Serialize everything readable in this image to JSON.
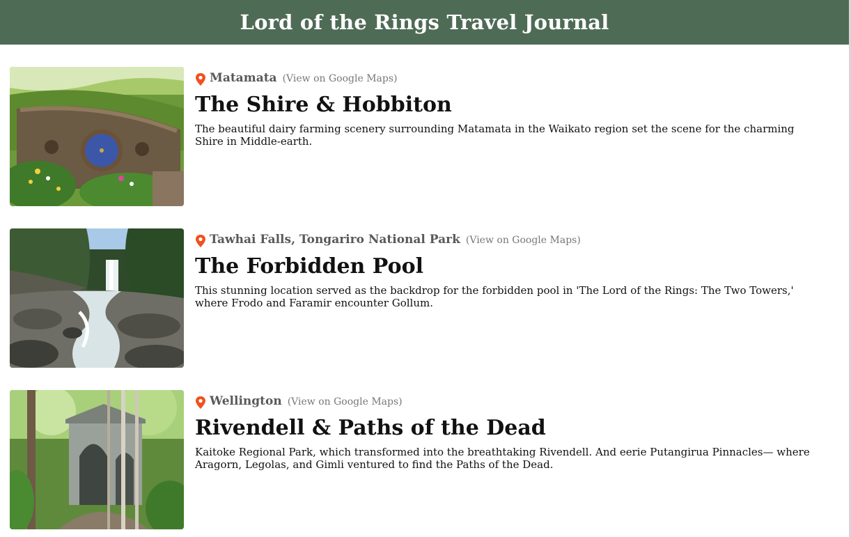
{
  "header": {
    "title": "Lord of the Rings Travel Journal"
  },
  "entries": [
    {
      "location": "Matamata",
      "maps_link": "(View on Google Maps)",
      "title": "The Shire & Hobbiton",
      "description": "The beautiful dairy farming scenery surrounding Matamata in the Waikato region set the scene for the charming Shire in Middle-earth."
    },
    {
      "location": "Tawhai Falls, Tongariro National Park",
      "maps_link": "(View on Google Maps)",
      "title": "The Forbidden Pool",
      "description": "This stunning location served as the backdrop for the forbidden pool in 'The Lord of the Rings: The Two Towers,' where Frodo and Faramir encounter Gollum."
    },
    {
      "location": "Wellington",
      "maps_link": "(View on Google Maps)",
      "title": "Rivendell & Paths of the Dead",
      "description": "Kaitoke Regional Park, which transformed into the breathtaking Rivendell. And eerie Putangirua Pinnacles— where Aragorn, Legolas, and Gimli ventured to find the Paths of the Dead."
    }
  ],
  "colors": {
    "header_bg": "#4e6b56",
    "pin": "#f0511f",
    "location_text": "#595959",
    "link_text": "#777777"
  },
  "icons": {
    "pin": "map-pin-icon"
  }
}
